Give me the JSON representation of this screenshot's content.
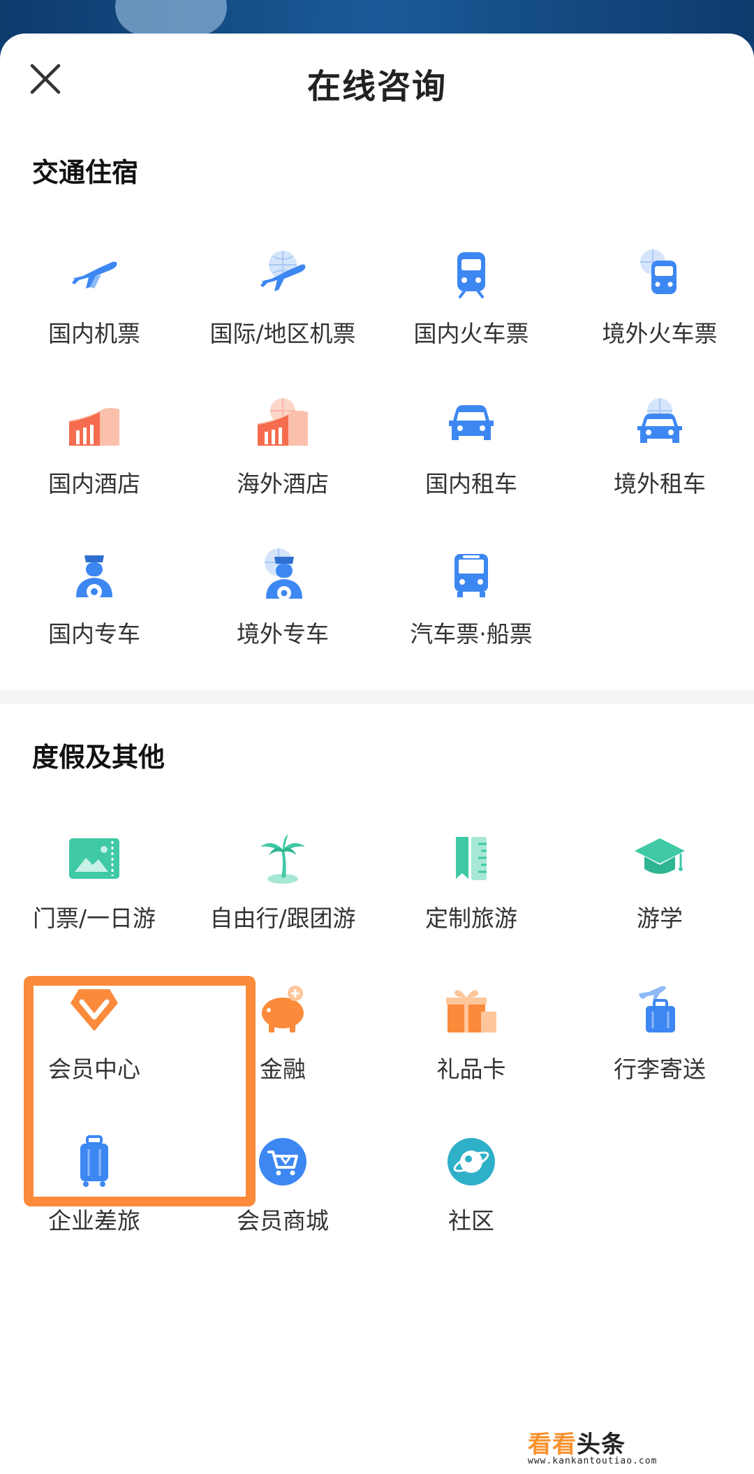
{
  "header": {
    "title": "在线咨询",
    "close_icon": "close-icon"
  },
  "sections": [
    {
      "title": "交通住宿",
      "items": [
        {
          "label": "国内机票",
          "icon": "plane-icon"
        },
        {
          "label": "国际/地区机票",
          "icon": "globe-plane-icon"
        },
        {
          "label": "国内火车票",
          "icon": "train-icon"
        },
        {
          "label": "境外火车票",
          "icon": "globe-train-icon"
        },
        {
          "label": "国内酒店",
          "icon": "hotel-icon"
        },
        {
          "label": "海外酒店",
          "icon": "globe-hotel-icon"
        },
        {
          "label": "国内租车",
          "icon": "car-icon"
        },
        {
          "label": "境外租车",
          "icon": "globe-car-icon"
        },
        {
          "label": "国内专车",
          "icon": "driver-icon"
        },
        {
          "label": "境外专车",
          "icon": "globe-driver-icon"
        },
        {
          "label": "汽车票·船票",
          "icon": "bus-icon"
        }
      ]
    },
    {
      "title": "度假及其他",
      "items": [
        {
          "label": "门票/一日游",
          "icon": "ticket-icon"
        },
        {
          "label": "自由行/跟团游",
          "icon": "palm-tree-icon"
        },
        {
          "label": "定制旅游",
          "icon": "ruler-icon"
        },
        {
          "label": "游学",
          "icon": "graduation-cap-icon"
        },
        {
          "label": "会员中心",
          "icon": "member-badge-icon"
        },
        {
          "label": "金融",
          "icon": "piggy-bank-icon"
        },
        {
          "label": "礼品卡",
          "icon": "gift-icon"
        },
        {
          "label": "行李寄送",
          "icon": "luggage-plane-icon"
        },
        {
          "label": "企业差旅",
          "icon": "suitcase-icon"
        },
        {
          "label": "会员商城",
          "icon": "shopping-cart-icon"
        },
        {
          "label": "社区",
          "icon": "planet-icon"
        }
      ]
    }
  ],
  "watermark": {
    "text_orange": "看看",
    "text_dark": "头条",
    "url": "www.kankantoutiao.com"
  },
  "colors": {
    "accent_blue": "#3d87f2",
    "hotel_red": "#f56c4e",
    "green": "#3fc9a4",
    "orange": "#fb8a3b",
    "highlight": "#fb8a3b"
  }
}
